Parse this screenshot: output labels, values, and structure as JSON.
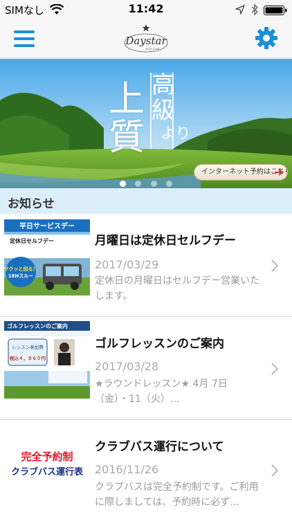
{
  "status_bar": {
    "carrier": "SIMなし",
    "time": "11:42"
  },
  "nav": {
    "logo_text": "Daystar",
    "logo_subtext": "GOLF CLUB"
  },
  "banner": {
    "kanji_tall": "高級",
    "kanji_big": "上質",
    "kanji_small": "より",
    "reserve_button": "インターネット予約はこちら",
    "dots": 4,
    "active_dot": 1
  },
  "section": {
    "title": "お知らせ"
  },
  "news": [
    {
      "title": "月曜日は定休日セルフデー",
      "date": "2017/03/29",
      "description": "定休日の月曜日はセルフデー営業いたします。",
      "thumb": {
        "header": "平日サービスデー",
        "subheader": "定休日セルフデー",
        "badge_line1": "サクッと回る！",
        "badge_line2": "18Hスルー"
      }
    },
    {
      "title": "ゴルフレッスンのご案内",
      "date": "2017/03/28",
      "description": "★ラウンドレッスン★ 4月 7日（金）・11（火）…",
      "thumb": {
        "header": "ゴルフレッスンのご案内",
        "price_label": "レッスン参加費",
        "price": "税込４，８６０円"
      }
    },
    {
      "title": "クラブバス運行について",
      "date": "2016/11/26",
      "description": "クラブバスは完全予約制です。ご利用に際しましては、予約時に必ず…",
      "thumb": {
        "line1": "完全予約制",
        "line2": "クラブバス運行表"
      }
    }
  ],
  "colors": {
    "accent": "#1a8fd8",
    "section_bg": "#dceefa",
    "date_gray": "#a9a9a9"
  }
}
